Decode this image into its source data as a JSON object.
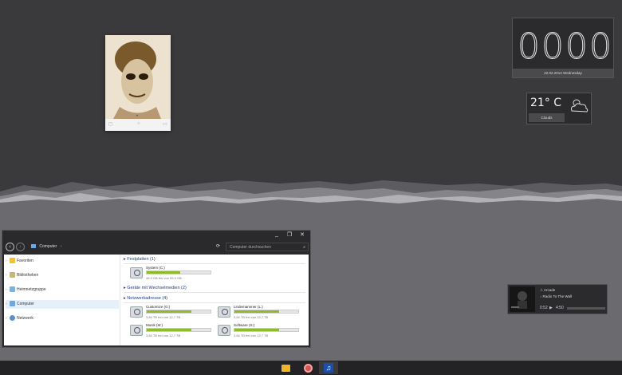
{
  "clock": {
    "h1": "0",
    "h2": "0",
    "m1": "0",
    "m2": "0",
    "date": "22.02.2014 Wednesday"
  },
  "weather": {
    "temp": "21° C",
    "condition": "Clouds"
  },
  "explorer": {
    "address": "Computer",
    "search_placeholder": "Computer durchsuchen",
    "window_buttons": [
      "_",
      "❐",
      "✕"
    ],
    "sidebar": [
      {
        "label": "Favoriten",
        "icon": "star-icon"
      },
      {
        "label": "Bibliotheken",
        "icon": "library-icon"
      },
      {
        "label": "Heimnetzgruppe",
        "icon": "homegroup-icon"
      },
      {
        "label": "Computer",
        "icon": "computer-icon",
        "selected": true
      },
      {
        "label": "Netzwerk",
        "icon": "network-icon"
      }
    ],
    "groups": {
      "fixed": "Festplatten (1)",
      "removable": "Geräte mit Wechselmedien (2)",
      "network": "Netzwerkadresse (4)"
    },
    "system_drive": {
      "name": "System (C:)",
      "free": "46,9 GB frei von 99,9 GB",
      "used_pct": 53
    },
    "network_drives": [
      {
        "name": "Customize (G:)",
        "free": "3,84 TB frei von 12,7 TB",
        "used_pct": 70
      },
      {
        "name": "Lindemannner (L:)",
        "free": "3,84 TB frei von 12,7 TB",
        "used_pct": 70
      },
      {
        "name": "Musik (M:)",
        "free": "3,84 TB frei von 12,7 TB",
        "used_pct": 70
      },
      {
        "name": "Software (S:)",
        "free": "3,84 TB frei von 12,7 TB",
        "used_pct": 70
      }
    ]
  },
  "music": {
    "artist": "Arcade",
    "title": "Radio To The Wall",
    "elapsed": "0:52",
    "total": "4:50"
  },
  "taskbar": {
    "items": [
      {
        "name": "explorer-icon",
        "color": "#f0b429"
      },
      {
        "name": "media-icon",
        "color": "#d9534f"
      },
      {
        "name": "music-icon",
        "color": "#1c4fa8"
      }
    ]
  },
  "colors": {
    "accent_green": "#8dbb2b",
    "desktop_dark": "#3a3a3d",
    "desktop_ground": "#6b6b6f"
  }
}
